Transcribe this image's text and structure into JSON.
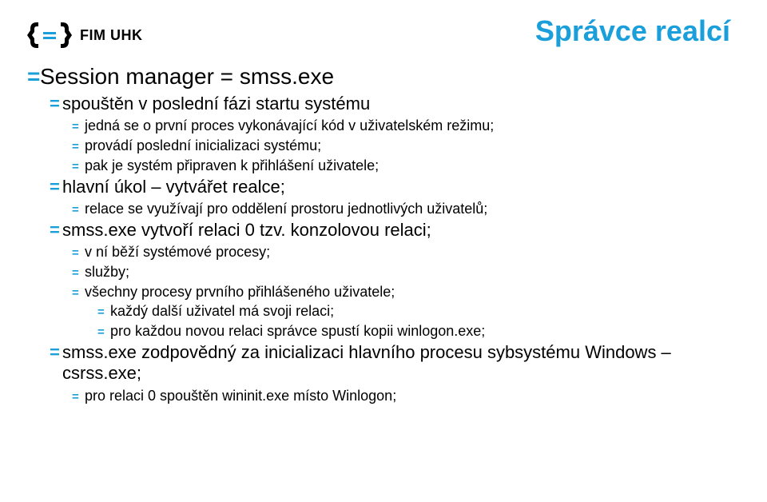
{
  "logo_text": "FIM UHK",
  "title": "Správce realcí",
  "bullet": "=",
  "l0": {
    "a": "Session manager = smss.exe"
  },
  "l1": {
    "a": "spouštěn v poslední fázi startu systému",
    "b": "hlavní úkol – vytvářet realce;",
    "c": "smss.exe vytvoří relaci 0 tzv. konzolovou relaci;",
    "d": "smss.exe zodpovědný za inicializaci hlavního procesu sybsystému Windows – csrss.exe;"
  },
  "l2": {
    "a": "jedná se o první proces vykonávající kód v uživatelském režimu;",
    "b": "provádí poslední inicializaci systému;",
    "c": "pak je systém připraven k přihlášení uživatele;",
    "d": "relace se využívají pro oddělení prostoru jednotlivých uživatelů;",
    "e": "v ní běží systémové procesy;",
    "f": "služby;",
    "g": "všechny procesy prvního přihlášeného uživatele;",
    "h": "pro relaci 0 spouštěn wininit.exe místo Winlogon;"
  },
  "l3": {
    "a": "každý další uživatel má svoji relaci;",
    "b": "pro každou novou relaci správce spustí kopii winlogon.exe;"
  }
}
